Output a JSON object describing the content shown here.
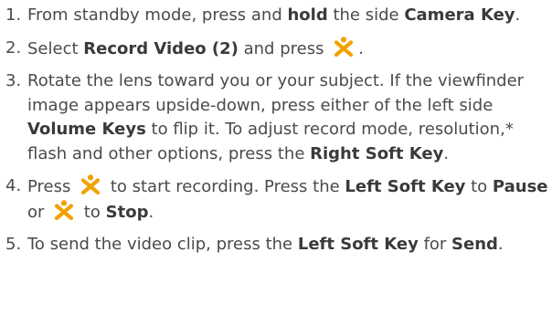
{
  "icons": {
    "ok_key": "ok-key-icon",
    "ok_key_color": "#f2a200"
  },
  "steps": [
    {
      "num": "1.",
      "a": "From standby mode, press and ",
      "b": "hold",
      "c": " the side ",
      "d": "Camera Key",
      "e": "."
    },
    {
      "num": "2.",
      "a": "Select ",
      "b": "Record Video (2)",
      "c": " and press",
      "d": "."
    },
    {
      "num": "3.",
      "a": "Rotate the lens toward you or your subject. If the viewfinder image appears upside-down, press either of the left side ",
      "b": "Volume Keys",
      "c": " to flip it. To adjust record mode, resolution,* flash and other options, press the ",
      "d": "Right Soft Key",
      "e": "."
    },
    {
      "num": "4.",
      "a": "Press",
      "b": " to start recording. Press the ",
      "c": "Left Soft Key",
      "d": " to ",
      "e": "Pause",
      "f": " or",
      "g": " to ",
      "h": "Stop",
      "i": "."
    },
    {
      "num": "5.",
      "a": "To send the video clip, press the ",
      "b": "Left Soft Key",
      "c": " for ",
      "d": "Send",
      "e": "."
    }
  ]
}
